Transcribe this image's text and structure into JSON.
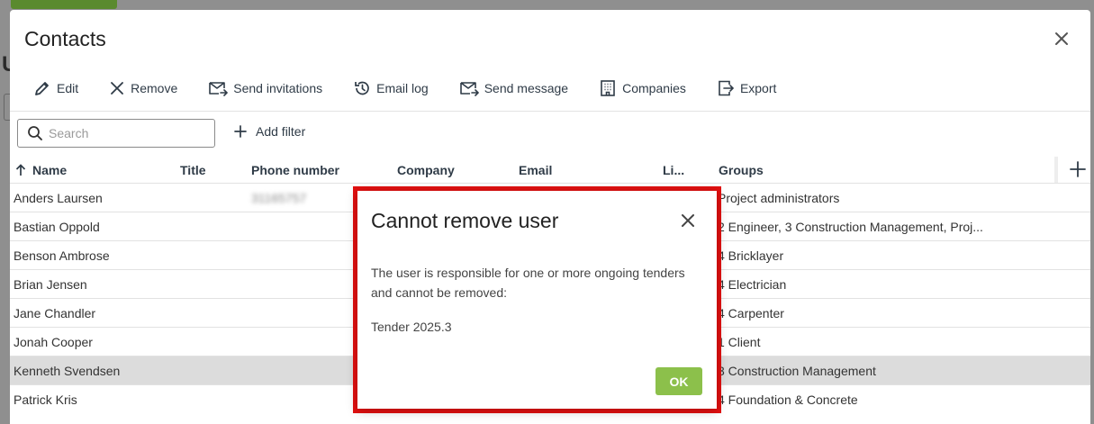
{
  "panel": {
    "title": "Contacts"
  },
  "toolbar": {
    "edit": "Edit",
    "remove": "Remove",
    "send_invitations": "Send invitations",
    "email_log": "Email log",
    "send_message": "Send message",
    "companies": "Companies",
    "export": "Export"
  },
  "search": {
    "placeholder": "Search"
  },
  "filter": {
    "add_label": "Add filter"
  },
  "table": {
    "columns": {
      "name": "Name",
      "title": "Title",
      "phone": "Phone number",
      "company": "Company",
      "email": "Email",
      "li": "Li...",
      "groups": "Groups"
    },
    "rows": [
      {
        "name": "Anders Laursen",
        "phone": "31165757",
        "groups": "Project administrators"
      },
      {
        "name": "Bastian Oppold",
        "phone": "",
        "groups": "2 Engineer, 3 Construction Management, Proj..."
      },
      {
        "name": "Benson Ambrose",
        "phone": "",
        "groups": "4 Bricklayer"
      },
      {
        "name": "Brian Jensen",
        "phone": "",
        "groups": "4 Electrician"
      },
      {
        "name": "Jane Chandler",
        "phone": "",
        "groups": "4 Carpenter"
      },
      {
        "name": "Jonah Cooper",
        "phone": "",
        "groups": "1 Client"
      },
      {
        "name": "Kenneth Svendsen",
        "phone": "",
        "groups": "3 Construction Management",
        "selected": true
      },
      {
        "name": "Patrick Kris",
        "phone": "",
        "groups": "4 Foundation & Concrete"
      }
    ]
  },
  "dialog": {
    "title": "Cannot remove user",
    "message": "The user is responsible for one or more ongoing tenders and cannot be removed:",
    "tender": "Tender 2025.3",
    "ok": "OK"
  },
  "colors": {
    "accent_green": "#8cc04b",
    "annotation_red": "#e31010",
    "selected_row": "#dcdcdc"
  },
  "icons": [
    "close-icon",
    "pencil-icon",
    "x-icon",
    "envelope-arrow-icon",
    "history-icon",
    "building-icon",
    "export-icon",
    "search-icon",
    "plus-icon",
    "sort-asc-icon"
  ]
}
